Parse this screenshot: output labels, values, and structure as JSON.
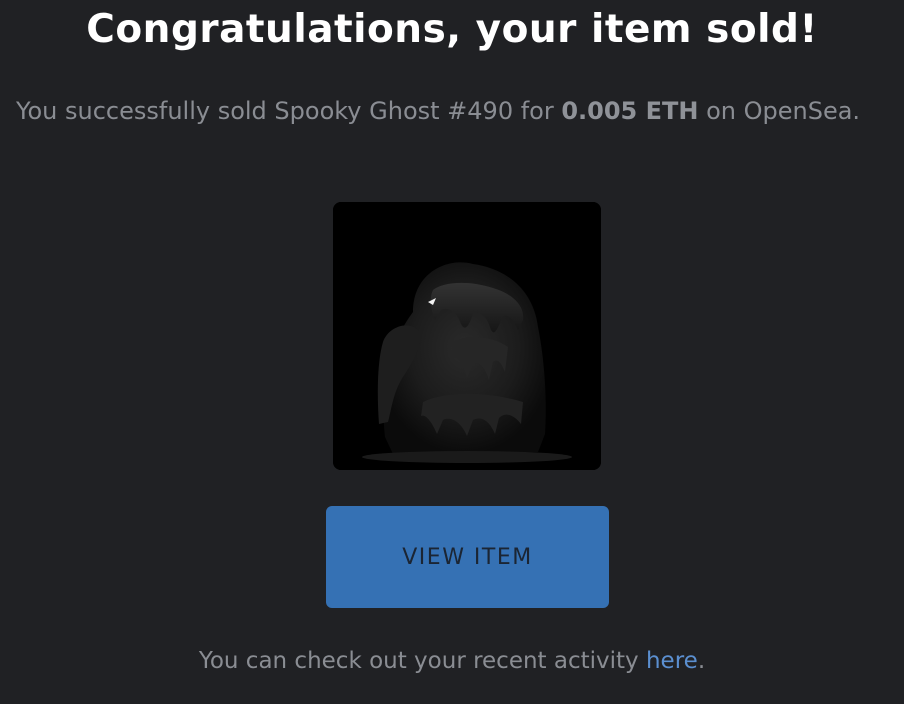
{
  "header": {
    "title": "Congratulations, your item sold!"
  },
  "sale_message": {
    "prefix": "You successfully sold Spooky Ghost #490 for ",
    "price": "0.005 ETH",
    "suffix": " on OpenSea."
  },
  "item": {
    "image_icon": "ghost-nft-image"
  },
  "actions": {
    "view_item_label": "VIEW ITEM"
  },
  "footer": {
    "text_prefix": "You can check out your recent activity ",
    "link_label": "here",
    "text_suffix": "."
  },
  "colors": {
    "background": "#202124",
    "button": "#3571b4",
    "link": "#5b8fd0",
    "body_text": "#8a8d93"
  }
}
